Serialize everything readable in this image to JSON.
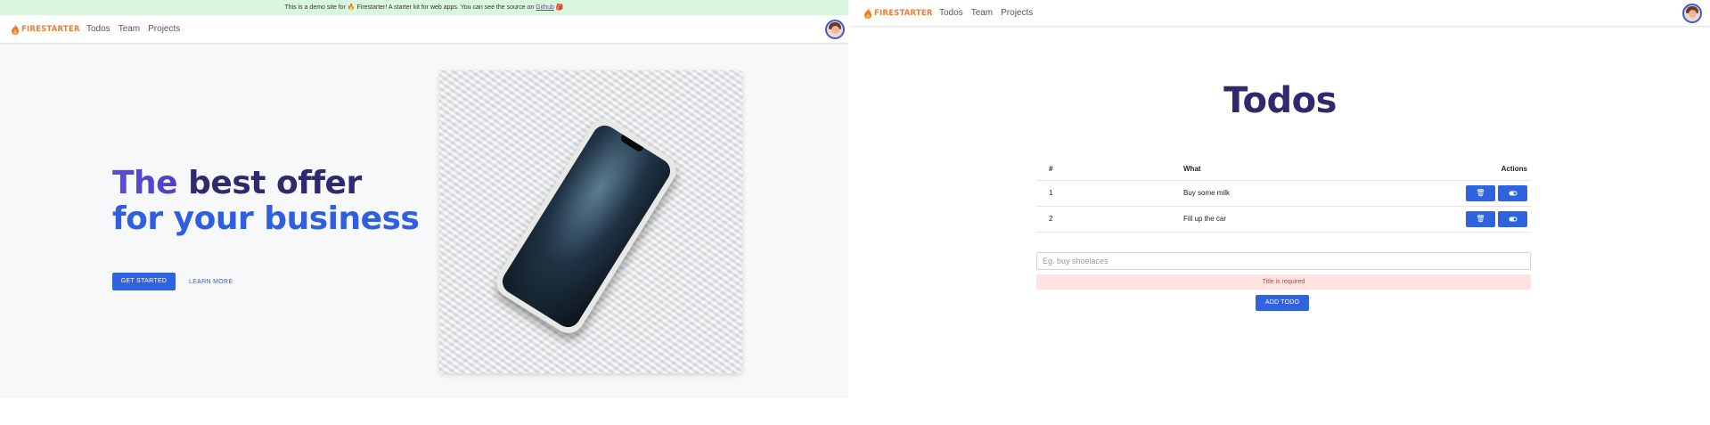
{
  "left": {
    "banner": {
      "text_before": "This is a demo site for 🔥 Firestarter! A starter kit for web apps. You can see the source on ",
      "link": "Github",
      "text_after": " 🎒"
    },
    "nav": {
      "brand": "FIRESTARTER",
      "links": [
        "Todos",
        "Team",
        "Projects"
      ]
    },
    "hero": {
      "line1_a": "The ",
      "line1_b": "best offer",
      "line2": "for your business",
      "primary_cta": "GET STARTED",
      "secondary_cta": "LEARN MORE"
    }
  },
  "right": {
    "nav": {
      "brand": "FIRESTARTER",
      "links": [
        "Todos",
        "Team",
        "Projects"
      ]
    },
    "title": "Todos",
    "table": {
      "headers": [
        "#",
        "What",
        "Actions"
      ],
      "rows": [
        {
          "num": "1",
          "what": "Buy some milk"
        },
        {
          "num": "2",
          "what": "Fill up the car"
        }
      ]
    },
    "input": {
      "placeholder": "Eg. buy shoelaces",
      "value": ""
    },
    "error": "Title is required",
    "add_button": "ADD TODO"
  },
  "icons": {
    "brand": "flame-icon",
    "delete": "trash-icon",
    "toggle": "toggle-icon",
    "avatar": "user-avatar"
  },
  "colors": {
    "accent": "#2f63e0",
    "title_dark": "#2f2a6e",
    "brand_orange": "#f07a2b",
    "banner_bg": "#d9f7dd",
    "error_bg": "#fde2e2",
    "error_text": "#d33b3b"
  }
}
